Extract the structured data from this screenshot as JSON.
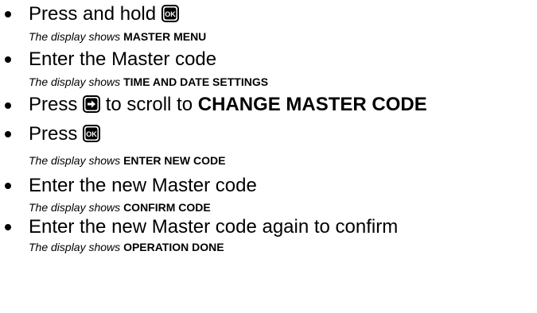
{
  "steps": [
    {
      "text_before": "Press and hold",
      "key": "ok-key",
      "text_after": "",
      "bold_text": "",
      "note_intro": "The display shows",
      "note_value": "MASTER MENU"
    },
    {
      "text_before": "Enter the Master code",
      "key": "",
      "text_after": "",
      "bold_text": "",
      "note_intro": "The display shows",
      "note_value": "TIME AND DATE SETTINGS"
    },
    {
      "text_before": "Press",
      "key": "right-arrow-key",
      "text_after": "to scroll to",
      "bold_text": "CHANGE MASTER CODE",
      "note_intro": "",
      "note_value": ""
    },
    {
      "text_before": "Press",
      "key": "ok-key",
      "text_after": "",
      "bold_text": "",
      "note_intro": "The display shows",
      "note_value": "ENTER NEW CODE"
    },
    {
      "text_before": "Enter the new Master code",
      "key": "",
      "text_after": "",
      "bold_text": "",
      "note_intro": "The display shows",
      "note_value": "CONFIRM CODE"
    },
    {
      "text_before": "Enter the new Master code again to confirm",
      "key": "",
      "text_after": "",
      "bold_text": "",
      "note_intro": "The display shows",
      "note_value": "OPERATION DONE"
    }
  ],
  "keys": {
    "ok_label": "OK"
  }
}
